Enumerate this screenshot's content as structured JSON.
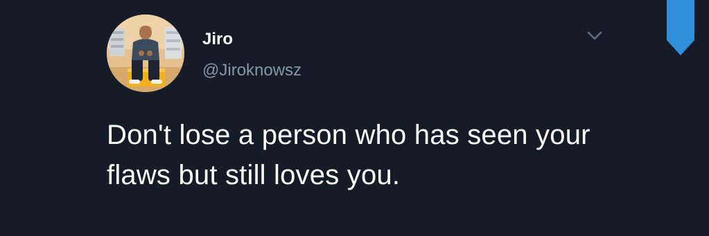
{
  "tweet": {
    "author": {
      "display_name": "Jiro",
      "handle": "@Jiroknowsz"
    },
    "text": "Don't lose a person who has seen your flaws but still loves you.",
    "icons": {
      "menu": "chevron-down-icon",
      "bookmark": "bookmark-icon"
    },
    "colors": {
      "background": "#151c28",
      "text": "#ffffff",
      "secondary_text": "#8696a8",
      "accent": "#2f8fd8"
    }
  }
}
